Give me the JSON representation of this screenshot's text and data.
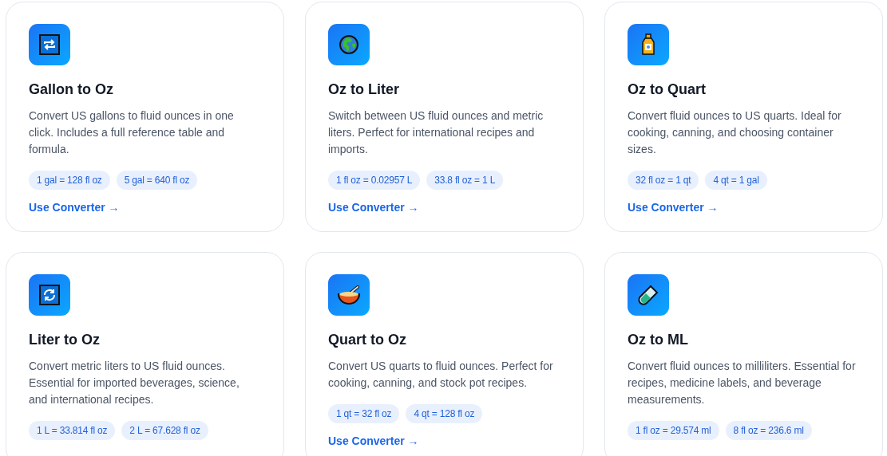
{
  "cards": [
    {
      "title": "Gallon to Oz",
      "description": "Convert US gallons to fluid ounces in one click. Includes a full reference table and formula.",
      "examples": [
        "1 gal = 128 fl oz",
        "5 gal = 640 fl oz"
      ],
      "link": "Use Converter →"
    },
    {
      "title": "Oz to Liter",
      "description": "Switch between US fluid ounces and metric liters. Perfect for international recipes and imports.",
      "examples": [
        "1 fl oz = 0.02957 L",
        "33.8 fl oz = 1 L"
      ],
      "link": "Use Converter →"
    },
    {
      "title": "Oz to Quart",
      "description": "Convert fluid ounces to US quarts. Ideal for cooking, canning, and choosing container sizes.",
      "examples": [
        "32 fl oz = 1 qt",
        "4 qt = 1 gal"
      ],
      "link": "Use Converter →"
    },
    {
      "title": "Liter to Oz",
      "description": "Convert metric liters to US fluid ounces. Essential for imported beverages, science, and international recipes.",
      "examples": [
        "1 L = 33.814 fl oz",
        "2 L = 67.628 fl oz"
      ]
    },
    {
      "title": "Quart to Oz",
      "description": "Convert US quarts to fluid ounces. Perfect for cooking, canning, and stock pot recipes.",
      "examples": [
        "1 qt = 32 fl oz",
        "4 qt = 128 fl oz"
      ],
      "link": "Use Converter →"
    },
    {
      "title": "Oz to ML",
      "description": "Convert fluid ounces to milliliters. Essential for recipes, medicine labels, and beverage measurements.",
      "examples": [
        "1 fl oz = 29.574 ml",
        "8 fl oz = 236.6 ml"
      ]
    }
  ]
}
